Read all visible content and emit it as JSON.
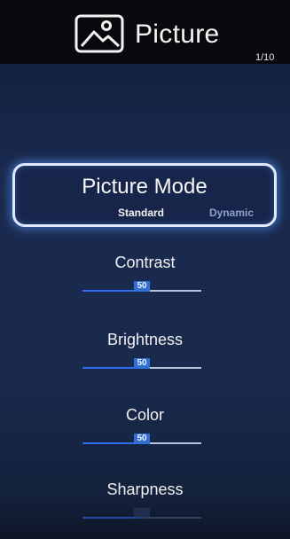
{
  "header": {
    "title": "Picture",
    "icon": "picture-icon",
    "page_counter": "1/10"
  },
  "picture_mode": {
    "label": "Picture Mode",
    "current": "Standard",
    "next": "Dynamic"
  },
  "settings": [
    {
      "label": "Contrast",
      "value": "50",
      "level_percent": 50
    },
    {
      "label": "Brightness",
      "value": "50",
      "level_percent": 50
    },
    {
      "label": "Color",
      "value": "50",
      "level_percent": 50
    },
    {
      "label": "Sharpness",
      "level_percent": 50
    }
  ],
  "colors": {
    "accent": "#2f6cf0",
    "focus_border": "#dfeaff",
    "background": "#1a2a4f"
  }
}
